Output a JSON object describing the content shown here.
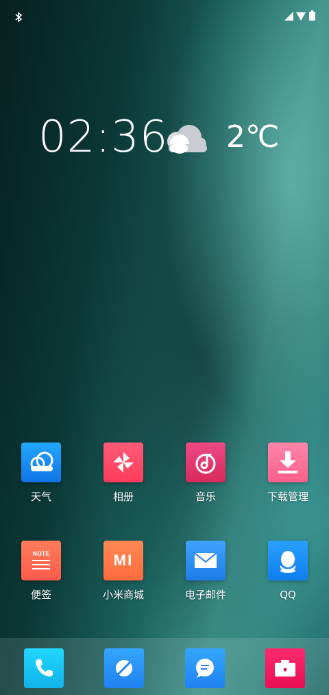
{
  "status_bar": {
    "left_icons": [
      "bluetooth-icon"
    ],
    "right_icons": [
      "signal-icon",
      "wifi-icon",
      "battery-icon"
    ]
  },
  "clock": {
    "time": "02:36"
  },
  "weather": {
    "temperature": "2℃",
    "icon": "cloudy-icon"
  },
  "apps_row1": [
    {
      "label": "天气",
      "icon": "weather-app-icon",
      "color": "#1e8df0"
    },
    {
      "label": "相册",
      "icon": "gallery-icon",
      "color": "#ff4f6a"
    },
    {
      "label": "音乐",
      "icon": "music-icon",
      "color": "#e03a6a"
    },
    {
      "label": "下载管理",
      "icon": "download-icon",
      "color": "#ff6f9a"
    }
  ],
  "apps_row2": [
    {
      "label": "便签",
      "icon": "notes-icon",
      "icon_text": "NOTE",
      "color": "#ff6b57"
    },
    {
      "label": "小米商城",
      "icon": "mi-store-icon",
      "icon_text": "MI",
      "color": "#ff7d4b"
    },
    {
      "label": "电子邮件",
      "icon": "email-icon",
      "color": "#2a8cf0"
    },
    {
      "label": "QQ",
      "icon": "qq-icon",
      "color": "#1890ff"
    }
  ],
  "dock": [
    {
      "icon": "phone-icon",
      "color": "#18c5f0"
    },
    {
      "icon": "browser-icon",
      "color": "#2a8ff5"
    },
    {
      "icon": "messages-icon",
      "color": "#2a8ff5"
    },
    {
      "icon": "camera-icon",
      "color": "#f0195e"
    }
  ]
}
